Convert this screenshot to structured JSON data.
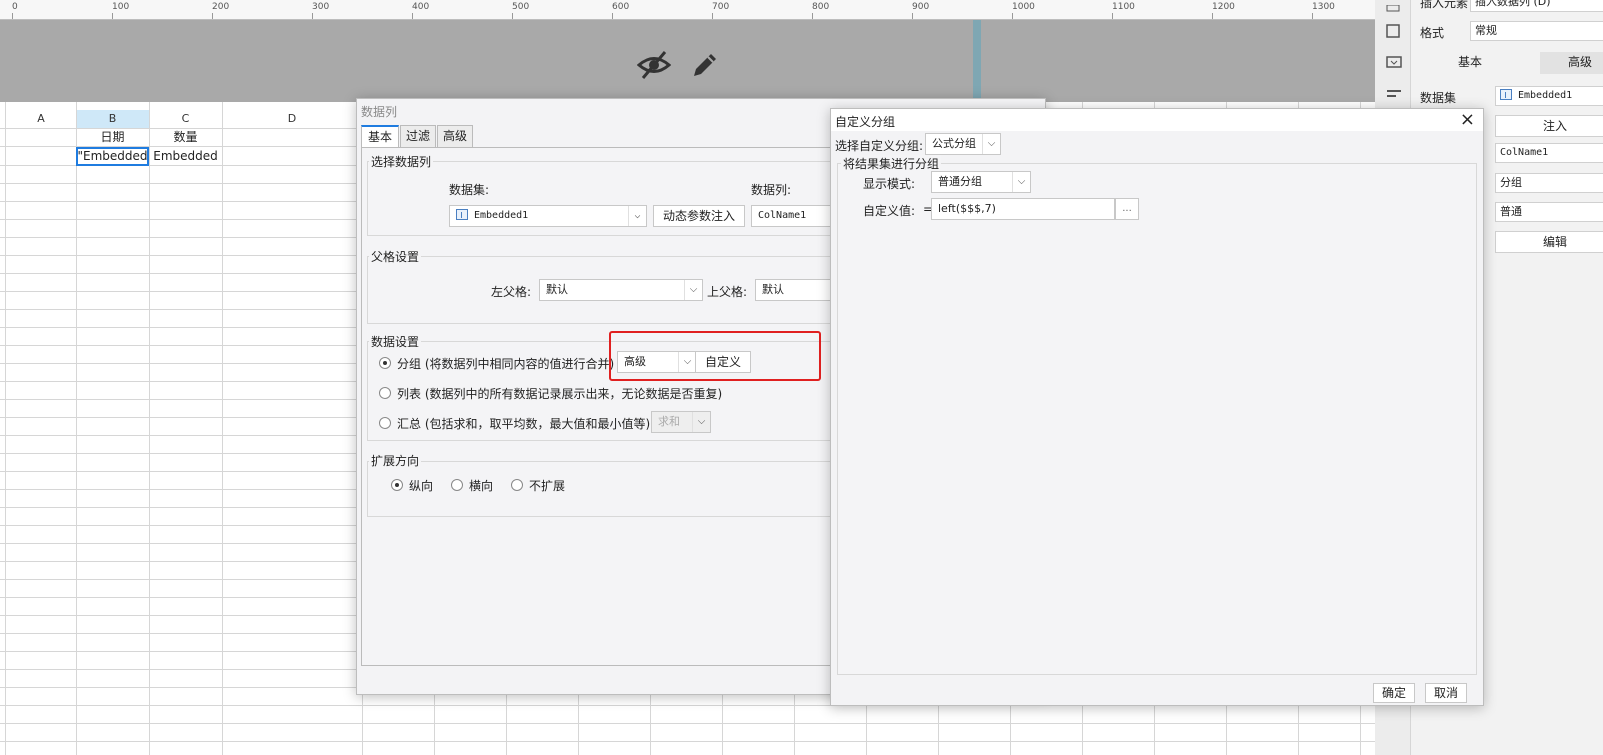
{
  "ruler": {
    "ticks": [
      "0",
      "100",
      "200",
      "300",
      "400",
      "500",
      "600",
      "700",
      "800",
      "900",
      "1000",
      "1100",
      "1200",
      "1300"
    ]
  },
  "canvas": {
    "icons": [
      "eye-off-icon",
      "pencil-icon"
    ]
  },
  "sheet": {
    "columns": [
      "A",
      "B",
      "C",
      "D"
    ],
    "row1": {
      "b": "日期",
      "c": "数量"
    },
    "row2": {
      "b": "\"Embedded",
      "c": "Embedded"
    }
  },
  "right_panel": {
    "insert_element_label": "插入元素",
    "insert_element_value": "插入数据列 (D)",
    "format_label": "格式",
    "format_value": "常规",
    "tab_basic": "基本",
    "tab_advanced": "高级",
    "dataset_label": "数据集",
    "dataset_value": "Embedded1",
    "inject_button": "注入",
    "column_value": "ColName1",
    "mode_value": "分组",
    "normal_value": "普通",
    "edit_button": "编辑"
  },
  "data_column_dialog": {
    "title": "数据列",
    "tabs": [
      "基本",
      "过滤",
      "高级"
    ],
    "select_section": "选择数据列",
    "dataset_label": "数据集:",
    "dataset_value": "Embedded1",
    "dynamic_inject_button": "动态参数注入",
    "column_label": "数据列:",
    "column_value": "ColName1",
    "parent_section": "父格设置",
    "left_parent_label": "左父格:",
    "left_parent_value": "默认",
    "top_parent_label": "上父格:",
    "top_parent_value": "默认",
    "data_section": "数据设置",
    "group_option": "分组 (将数据列中相同内容的值进行合并)",
    "group_mode_value": "高级",
    "custom_button": "自定义",
    "list_option": "列表 (数据列中的所有数据记录展示出来，无论数据是否重复)",
    "summary_option": "汇总 (包括求和，取平均数，最大值和最小值等)",
    "summary_value": "求和",
    "direction_section": "扩展方向",
    "dir_vertical": "纵向",
    "dir_horizontal": "横向",
    "dir_none": "不扩展"
  },
  "custom_group_dialog": {
    "title": "自定义分组",
    "close": "×",
    "select_label": "选择自定义分组:",
    "select_value": "公式分组",
    "group_section": "将结果集进行分组",
    "display_mode_label": "显示模式:",
    "display_mode_value": "普通分组",
    "custom_value_label": "自定义值:",
    "custom_value_eq": "=",
    "custom_value_formula": "left($$$,7)",
    "ellipsis_button": "...",
    "ok_button": "确定",
    "cancel_button": "取消"
  },
  "colors": {
    "highlight_red": "#e02020",
    "accent_blue": "#1f7ce0"
  }
}
